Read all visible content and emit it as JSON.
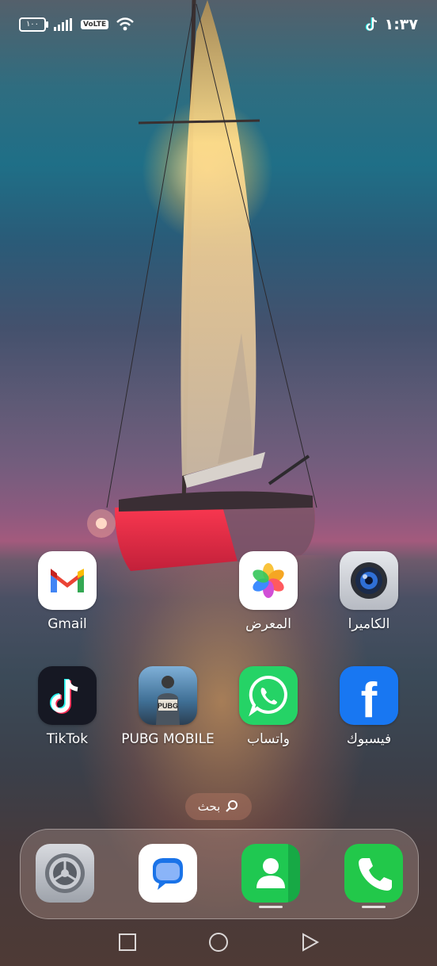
{
  "status_bar": {
    "battery": "١٠٠",
    "network_badge": "VoLTE",
    "time": "١:٣٧",
    "icons": [
      "battery-icon",
      "signal-icon",
      "volte-icon",
      "wifi-icon",
      "tiktok-notification-icon"
    ]
  },
  "apps": [
    {
      "name": "gmail",
      "label": "Gmail",
      "icon": "gmail-icon"
    },
    {
      "name": "gallery",
      "label": "المعرض",
      "icon": "gallery-icon"
    },
    {
      "name": "camera",
      "label": "الكاميرا",
      "icon": "camera-icon"
    },
    {
      "name": "tiktok",
      "label": "TikTok",
      "icon": "tiktok-icon"
    },
    {
      "name": "pubg",
      "label": "PUBG MOBILE",
      "icon": "pubg-icon",
      "icon_text": "PUBG"
    },
    {
      "name": "whatsapp",
      "label": "واتساب",
      "icon": "whatsapp-icon"
    },
    {
      "name": "facebook",
      "label": "فيسبوك",
      "icon": "facebook-icon",
      "icon_text": "f"
    }
  ],
  "search": {
    "label": "بحث",
    "icon": "search-icon"
  },
  "dock": [
    {
      "name": "settings",
      "icon": "settings-icon"
    },
    {
      "name": "messages",
      "icon": "messages-icon"
    },
    {
      "name": "contacts",
      "icon": "contacts-icon"
    },
    {
      "name": "phone",
      "icon": "phone-icon"
    }
  ],
  "nav": [
    "recents-button",
    "home-button",
    "back-button"
  ],
  "colors": {
    "whatsapp": "#25d366",
    "facebook": "#1877f2",
    "phone": "#22c84a",
    "contacts": "#1fc851",
    "tiktok_bg": "#161823"
  }
}
